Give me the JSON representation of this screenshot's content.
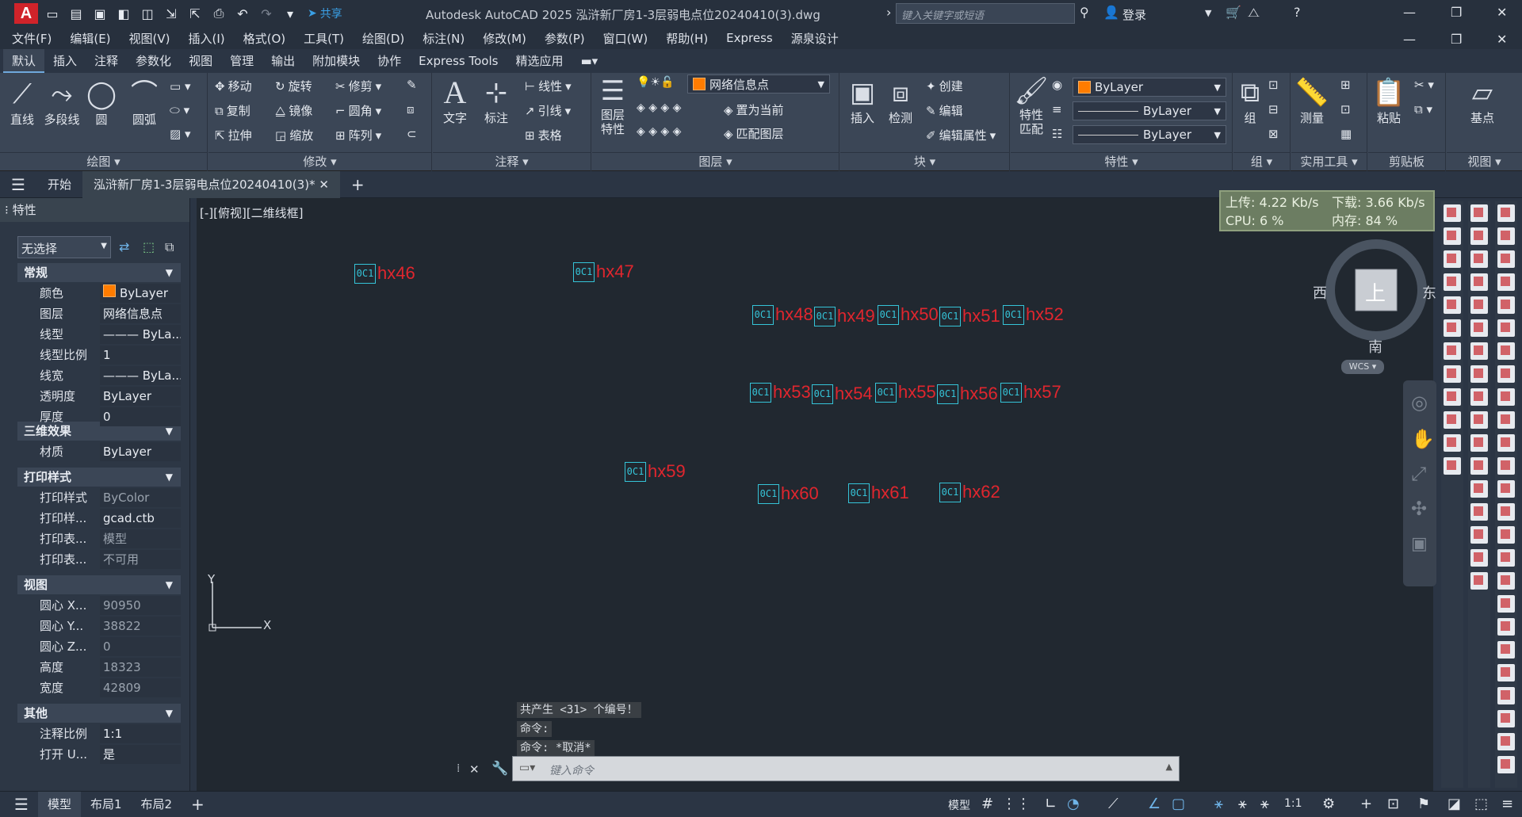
{
  "app": {
    "title": "Autodesk AutoCAD 2025    泓浒新厂房1-3层弱电点位20240410(3).dwg",
    "share_label": "共享",
    "search_placeholder": "键入关键字或短语",
    "login_label": "登录",
    "logo_letter": "A"
  },
  "menu": [
    "文件(F)",
    "编辑(E)",
    "视图(V)",
    "插入(I)",
    "格式(O)",
    "工具(T)",
    "绘图(D)",
    "标注(N)",
    "修改(M)",
    "参数(P)",
    "窗口(W)",
    "帮助(H)",
    "Express",
    "源泉设计"
  ],
  "ribbon_tabs": [
    "默认",
    "插入",
    "注释",
    "参数化",
    "视图",
    "管理",
    "输出",
    "附加模块",
    "协作",
    "Express Tools",
    "精选应用"
  ],
  "ribbon": {
    "draw": {
      "label": "绘图",
      "line": "直线",
      "polyline": "多段线",
      "circle": "圆",
      "arc": "圆弧"
    },
    "modify": {
      "label": "修改",
      "move": "移动",
      "rotate": "旋转",
      "trim": "修剪",
      "copy": "复制",
      "mirror": "镜像",
      "fillet": "圆角",
      "stretch": "拉伸",
      "scale": "缩放",
      "array": "阵列"
    },
    "annotation": {
      "label": "注释",
      "text": "文字",
      "dimension": "标注",
      "linear": "线性",
      "leader": "引线",
      "table": "表格"
    },
    "layers": {
      "label": "图层",
      "layer_props": "图层\n特性",
      "current_layer": "网络信息点",
      "set_current": "置为当前",
      "match_layer": "匹配图层"
    },
    "block": {
      "label": "块",
      "insert": "插入",
      "inspect": "检测",
      "create": "创建",
      "edit": "编辑",
      "edit_attr": "编辑属性"
    },
    "properties": {
      "label": "特性",
      "match": "特性\n匹配",
      "color": "ByLayer",
      "linetype": "ByLayer",
      "lineweight": "ByLayer"
    },
    "groups": {
      "label": "组",
      "group": "组"
    },
    "utilities": {
      "label": "实用工具",
      "measure": "测量"
    },
    "clipboard": {
      "label": "剪贴板",
      "paste": "粘贴"
    },
    "view": {
      "label": "视图",
      "base": "基点"
    }
  },
  "doc_tabs": {
    "start": "开始",
    "active": "泓浒新厂房1-3层弱电点位20240410(3)*"
  },
  "palette": {
    "title": "特性",
    "selection": "无选择",
    "sections": {
      "general": {
        "label": "常规",
        "rows": [
          {
            "k": "颜色",
            "v": "ByLayer"
          },
          {
            "k": "图层",
            "v": "网络信息点"
          },
          {
            "k": "线型",
            "v": "——— ByLa..."
          },
          {
            "k": "线型比例",
            "v": "1"
          },
          {
            "k": "线宽",
            "v": "——— ByLa..."
          },
          {
            "k": "透明度",
            "v": "ByLayer"
          },
          {
            "k": "厚度",
            "v": "0"
          }
        ]
      },
      "effects3d": {
        "label": "三维效果",
        "rows": [
          {
            "k": "材质",
            "v": "ByLayer"
          }
        ]
      },
      "plotstyle": {
        "label": "打印样式",
        "rows": [
          {
            "k": "打印样式",
            "v": "ByColor"
          },
          {
            "k": "打印样...",
            "v": "gcad.ctb"
          },
          {
            "k": "打印表...",
            "v": "模型"
          },
          {
            "k": "打印表...",
            "v": "不可用"
          }
        ]
      },
      "view": {
        "label": "视图",
        "rows": [
          {
            "k": "圆心 X...",
            "v": "90950"
          },
          {
            "k": "圆心 Y...",
            "v": "38822"
          },
          {
            "k": "圆心 Z...",
            "v": "0"
          },
          {
            "k": "高度",
            "v": "18323"
          },
          {
            "k": "宽度",
            "v": "42809"
          }
        ]
      },
      "misc": {
        "label": "其他",
        "rows": [
          {
            "k": "注释比例",
            "v": "1:1"
          },
          {
            "k": "打开 U...",
            "v": "是"
          }
        ]
      }
    }
  },
  "canvas": {
    "view_label": "[-][俯视][二维线框]",
    "block_glyph": "0C1",
    "tags": [
      "hx46",
      "hx47",
      "hx48",
      "hx49",
      "hx50",
      "hx51",
      "hx52",
      "hx53",
      "hx54",
      "hx55",
      "hx56",
      "hx57",
      "hx59",
      "hx60",
      "hx61",
      "hx62"
    ],
    "net_monitor": {
      "upload": "上传: 4.22 Kb/s",
      "download": "下载: 3.66 Kb/s",
      "cpu": "CPU: 6 %",
      "memory": "内存: 84 %"
    },
    "viewcube": {
      "top": "上",
      "west": "西",
      "east": "东",
      "south": "南",
      "wcs": "WCS"
    },
    "ucs": {
      "x": "X",
      "y": "Y"
    }
  },
  "command": {
    "history": [
      "共产生 <31> 个编号！",
      "命令:",
      "命令: *取消*"
    ],
    "placeholder": "键入命令"
  },
  "status": {
    "tabs": [
      "模型",
      "布局1",
      "布局2"
    ],
    "model": "模型",
    "scale": "1:1"
  }
}
